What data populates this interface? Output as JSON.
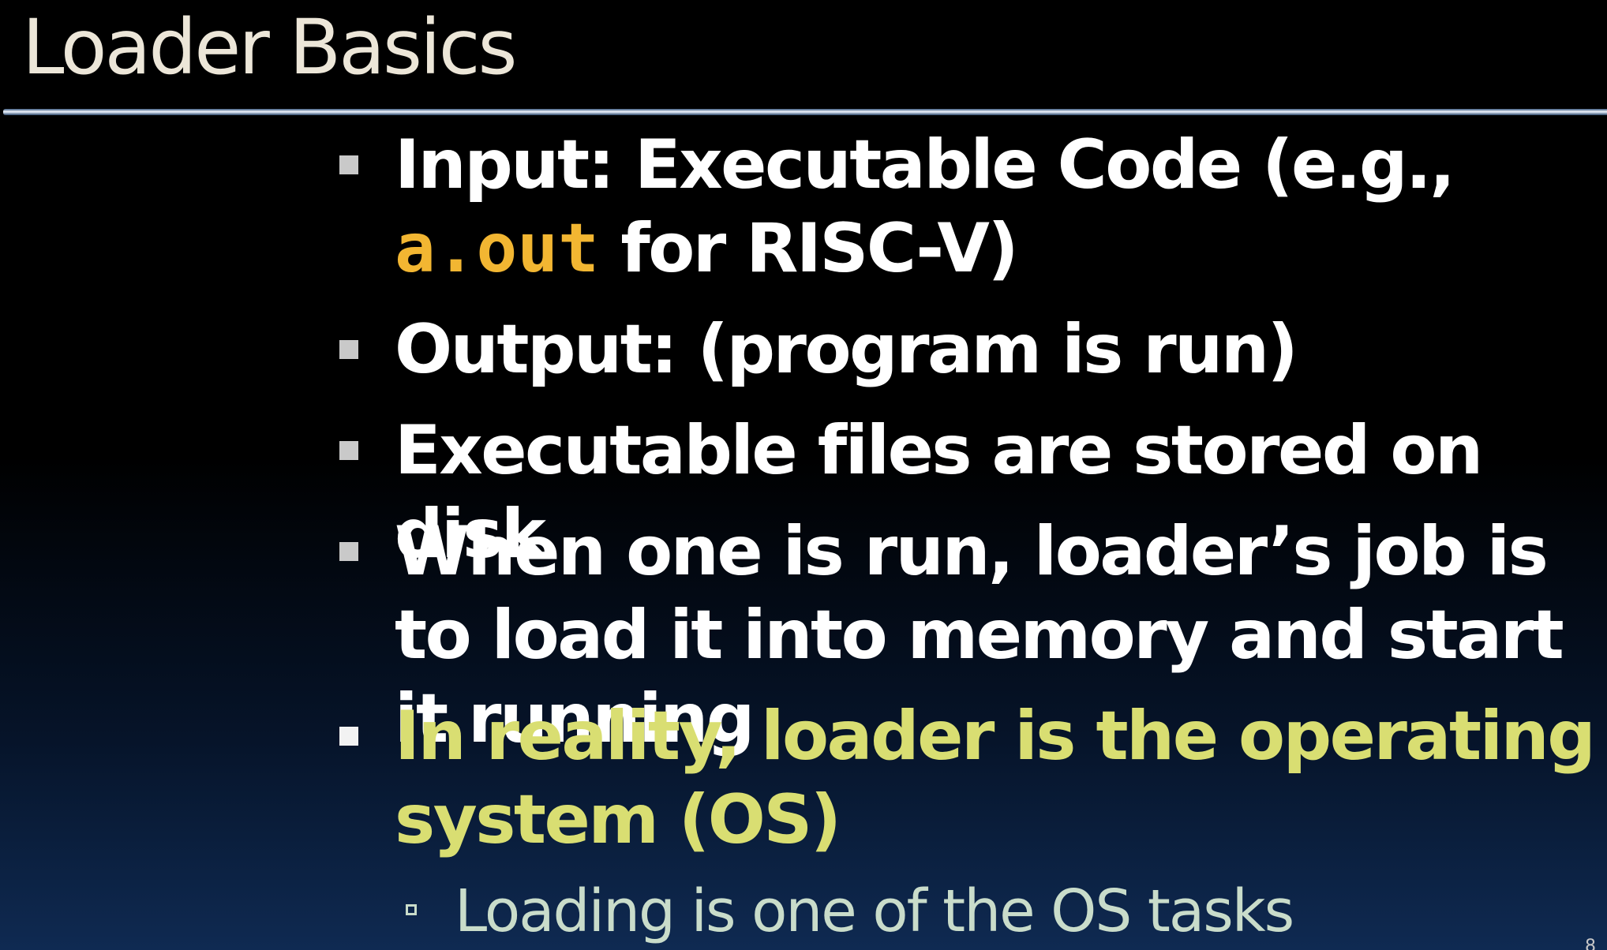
{
  "slide": {
    "title": "Loader Basics",
    "bullets": [
      {
        "before": "Input: Executable Code (e.g., ",
        "code": "a.out",
        "after": " for RISC-V)"
      },
      {
        "text": "Output: (program is run)"
      },
      {
        "text": "Executable files are stored on disk"
      },
      {
        "text": "When one is run, loader’s job is to load it into memory and start it running"
      },
      {
        "text": "In reality, loader is the operating system (OS)"
      }
    ],
    "sub_bullets": [
      {
        "text": "Loading is one of the OS tasks"
      }
    ],
    "page_number": "8"
  },
  "colors": {
    "title": "#ece6d8",
    "text": "#ffffff",
    "highlight": "#d9de72",
    "code": "#f2b632",
    "sub_text": "#c9dcca"
  }
}
